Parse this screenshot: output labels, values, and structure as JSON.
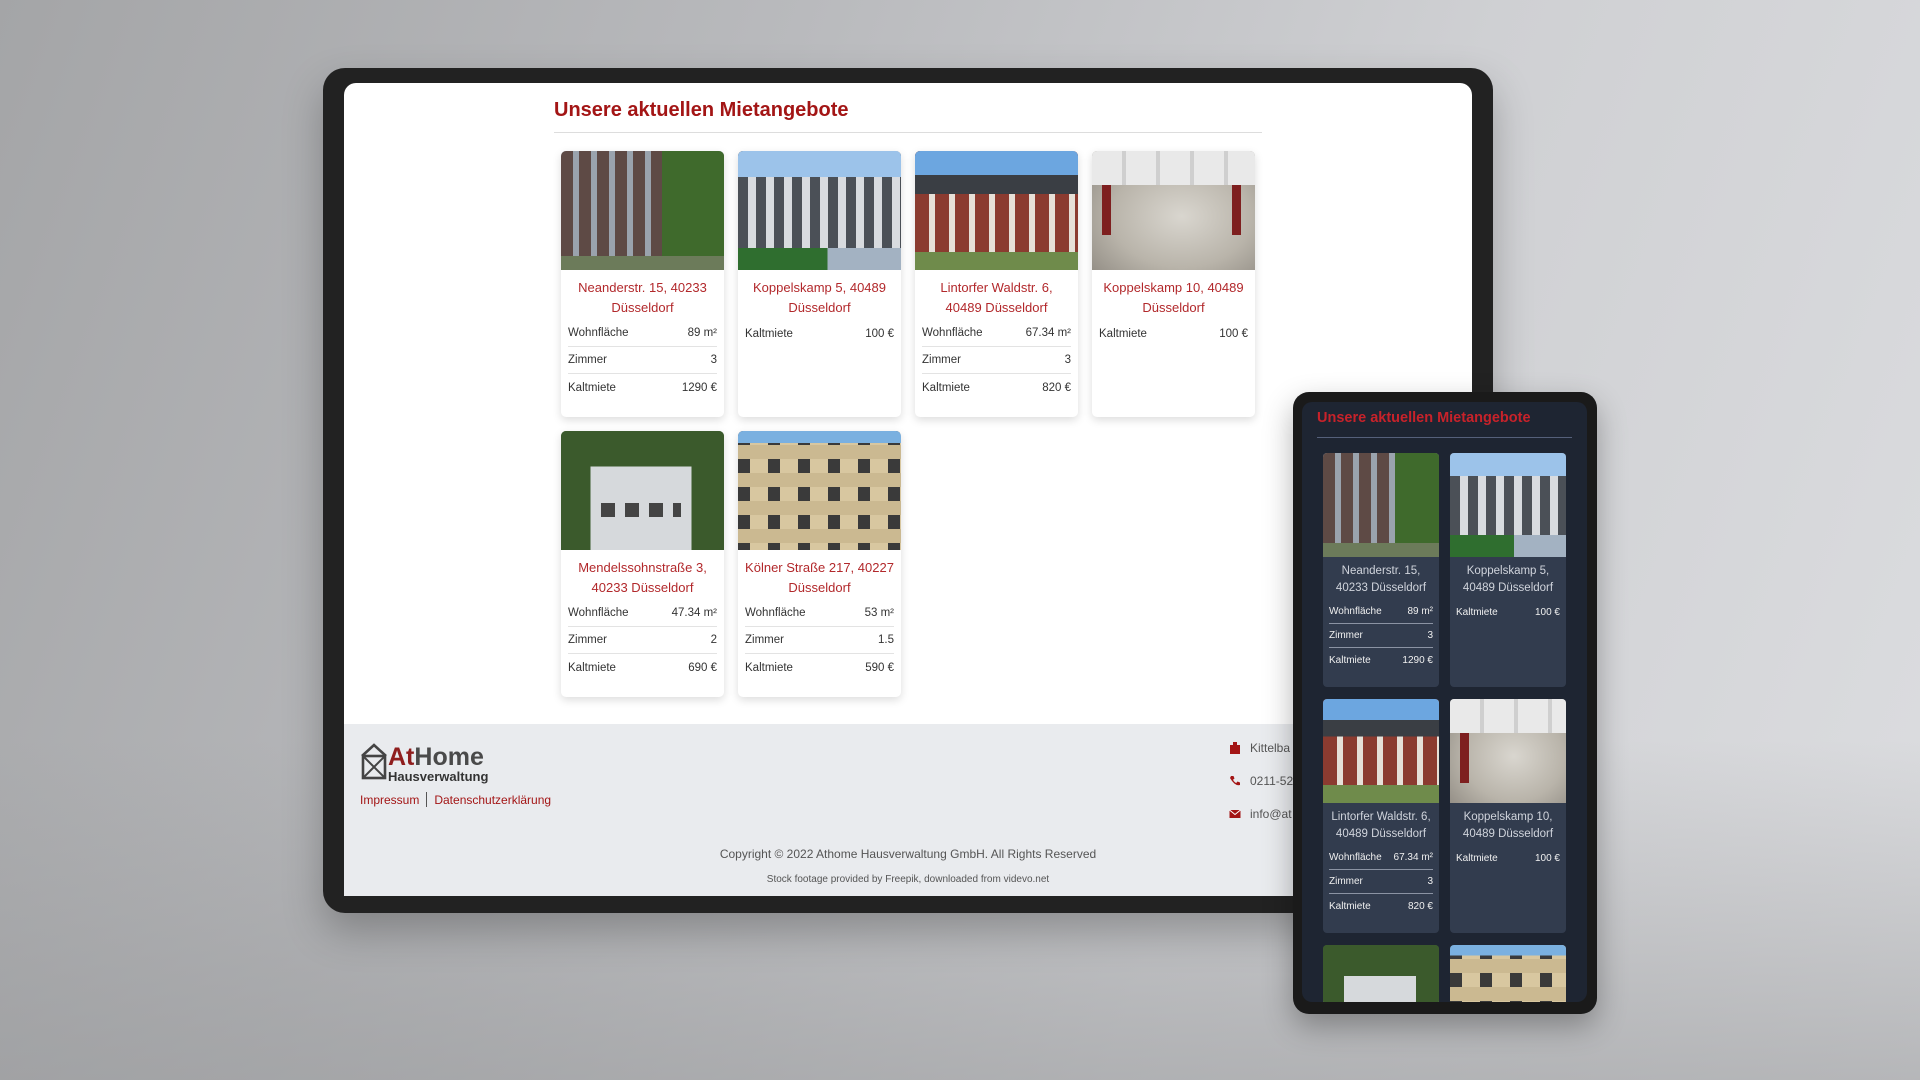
{
  "desktop": {
    "section_title": "Unsere aktuellen Mietangebote",
    "listings": [
      {
        "address": "Neanderstr. 15, 40233 Düsseldorf",
        "rows": [
          {
            "label": "Wohnfläche",
            "value": "89 m²"
          },
          {
            "label": "Zimmer",
            "value": "3"
          },
          {
            "label": "Kaltmiete",
            "value": "1290 €"
          }
        ]
      },
      {
        "address": "Koppelskamp 5, 40489 Düsseldorf",
        "rows": [
          {
            "label": "Kaltmiete",
            "value": "100 €"
          }
        ]
      },
      {
        "address": "Lintorfer Waldstr. 6, 40489 Düsseldorf",
        "rows": [
          {
            "label": "Wohnfläche",
            "value": "67.34 m²"
          },
          {
            "label": "Zimmer",
            "value": "3"
          },
          {
            "label": "Kaltmiete",
            "value": "820 €"
          }
        ]
      },
      {
        "address": "Koppelskamp 10, 40489 Düsseldorf",
        "rows": [
          {
            "label": "Kaltmiete",
            "value": "100 €"
          }
        ]
      },
      {
        "address": "Mendelssohnstraße 3, 40233 Düsseldorf",
        "rows": [
          {
            "label": "Wohnfläche",
            "value": "47.34 m²"
          },
          {
            "label": "Zimmer",
            "value": "2"
          },
          {
            "label": "Kaltmiete",
            "value": "690 €"
          }
        ]
      },
      {
        "address": "Kölner Straße 217, 40227 Düsseldorf",
        "rows": [
          {
            "label": "Wohnfläche",
            "value": "53 m²"
          },
          {
            "label": "Zimmer",
            "value": "1.5"
          },
          {
            "label": "Kaltmiete",
            "value": "590 €"
          }
        ]
      }
    ],
    "footer": {
      "logo": {
        "at": "At",
        "home": "Home",
        "sub": "Hausverwaltung"
      },
      "links": [
        "Impressum",
        "Datenschutzerklärung"
      ],
      "contact": [
        {
          "icon": "building-icon",
          "text": "Kittelba"
        },
        {
          "icon": "phone-icon",
          "text": "0211-52"
        },
        {
          "icon": "mail-icon",
          "text": "info@at"
        }
      ],
      "copyright": "Copyright © 2022 Athome Hausverwaltung GmbH. All Rights Reserved",
      "stock": "Stock footage provided by Freepik, downloaded from videvo.net"
    }
  },
  "mobile": {
    "section_title": "Unsere aktuellen Mietangebote",
    "listings": [
      {
        "address": "Neanderstr. 15, 40233 Düsseldorf",
        "rows": [
          {
            "label": "Wohnfläche",
            "value": "89 m²"
          },
          {
            "label": "Zimmer",
            "value": "3"
          },
          {
            "label": "Kaltmiete",
            "value": "1290 €"
          }
        ]
      },
      {
        "address": "Koppelskamp 5, 40489 Düsseldorf",
        "rows": [
          {
            "label": "Kaltmiete",
            "value": "100 €"
          }
        ]
      },
      {
        "address": "Lintorfer Waldstr. 6, 40489 Düsseldorf",
        "rows": [
          {
            "label": "Wohnfläche",
            "value": "67.34 m²"
          },
          {
            "label": "Zimmer",
            "value": "3"
          },
          {
            "label": "Kaltmiete",
            "value": "820 €"
          }
        ]
      },
      {
        "address": "Koppelskamp 10, 40489 Düsseldorf",
        "rows": [
          {
            "label": "Kaltmiete",
            "value": "100 €"
          }
        ]
      }
    ]
  },
  "colors": {
    "accent": "#a31515",
    "mobile_background": "#1e2532",
    "mobile_card": "#323c4e"
  }
}
